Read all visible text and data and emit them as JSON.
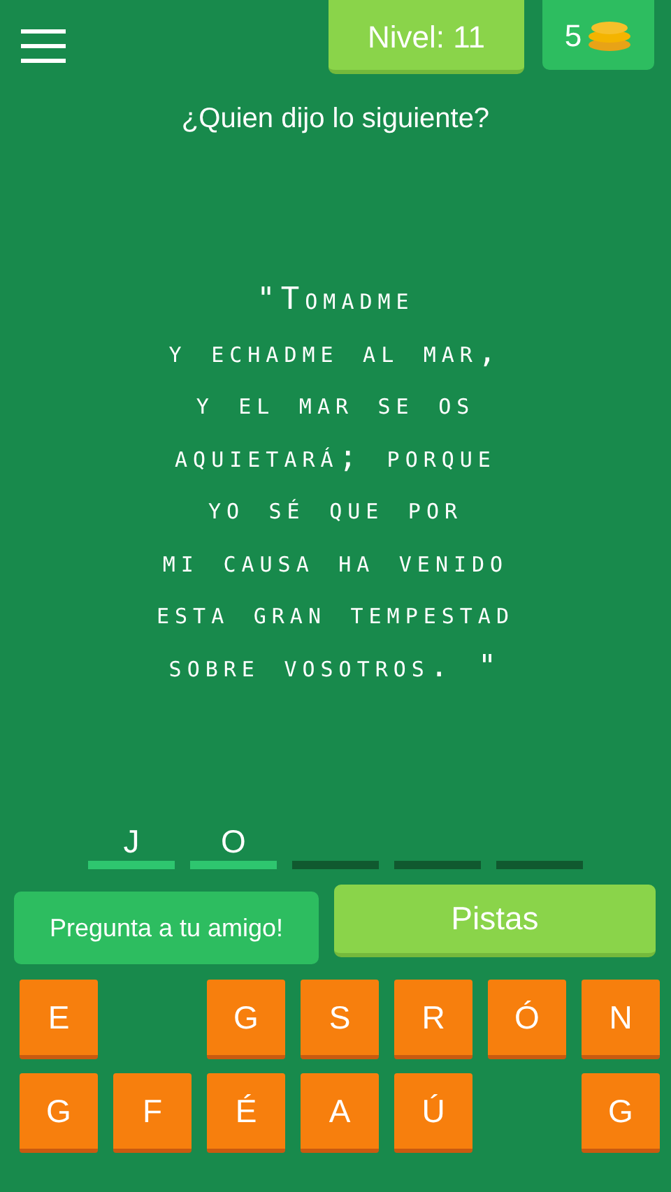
{
  "header": {
    "level_label": "Nivel: 11",
    "coins": "5"
  },
  "question": "¿Quien dijo lo siguiente?",
  "quote_lines": [
    "\"Tomadme",
    "y echadme al mar,",
    "y el mar se os",
    "aquietará; porque",
    "yo sé que por",
    "mi causa ha venido",
    "esta gran tempestad",
    "sobre vosotros. \""
  ],
  "answer_slots": [
    {
      "letter": "J",
      "filled": true
    },
    {
      "letter": "O",
      "filled": true
    },
    {
      "filled": false
    },
    {
      "filled": false
    },
    {
      "filled": false
    }
  ],
  "buttons": [
    {
      "kind": "friend",
      "label": "Pregunta a tu amigo!"
    },
    {
      "kind": "hints",
      "label": "Pistas"
    }
  ],
  "keyboard": [
    [
      {
        "kind": "letter",
        "letter": "E"
      },
      {
        "kind": "empty"
      },
      {
        "kind": "letter",
        "letter": "G"
      },
      {
        "kind": "letter",
        "letter": "S"
      },
      {
        "kind": "letter",
        "letter": "R"
      },
      {
        "kind": "letter",
        "letter": "Ó"
      },
      {
        "kind": "letter",
        "letter": "N"
      }
    ],
    [
      {
        "kind": "letter",
        "letter": "G"
      },
      {
        "kind": "letter",
        "letter": "F"
      },
      {
        "kind": "letter",
        "letter": "É"
      },
      {
        "kind": "letter",
        "letter": "A"
      },
      {
        "kind": "letter",
        "letter": "Ú"
      },
      {
        "kind": "empty"
      },
      {
        "kind": "letter",
        "letter": "G"
      }
    ]
  ]
}
